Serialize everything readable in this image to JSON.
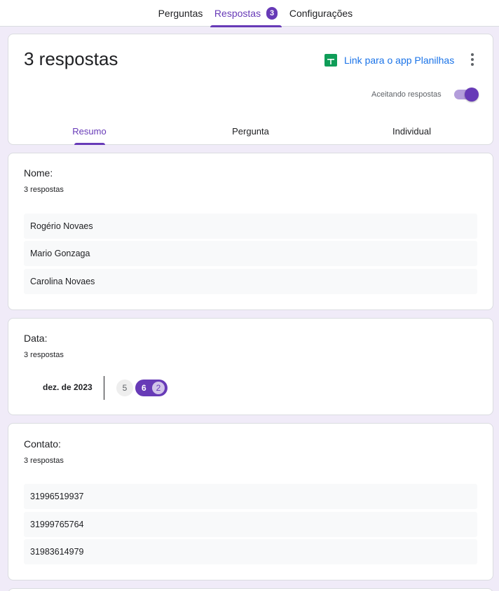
{
  "top_tabs": [
    {
      "label": "Perguntas",
      "active": false
    },
    {
      "label": "Respostas",
      "active": true,
      "badge": "3"
    },
    {
      "label": "Configurações",
      "active": false
    }
  ],
  "header": {
    "title": "3 respostas",
    "sheets_link": "Link para o app Planilhas",
    "accepting_label": "Aceitando respostas",
    "accepting": true
  },
  "sub_tabs": [
    {
      "label": "Resumo",
      "active": true
    },
    {
      "label": "Pergunta",
      "active": false
    },
    {
      "label": "Individual",
      "active": false
    }
  ],
  "questions": [
    {
      "title": "Nome:",
      "count": "3 respostas",
      "answers": [
        "Rogério Novaes",
        "Mario Gonzaga",
        "Carolina Novaes"
      ]
    },
    {
      "title": "Data:",
      "count": "3 respostas",
      "month": "dez. de 2023",
      "days": [
        {
          "day": "5"
        },
        {
          "day": "6",
          "count": "2"
        }
      ]
    },
    {
      "title": "Contato:",
      "count": "3 respostas",
      "answers": [
        "31996519937",
        "31999765764",
        "31983614979"
      ]
    }
  ],
  "colors": {
    "accent": "#673ab7",
    "background": "#f0ebf8",
    "link": "#1a73e8",
    "sheets_green": "#0f9d58"
  }
}
